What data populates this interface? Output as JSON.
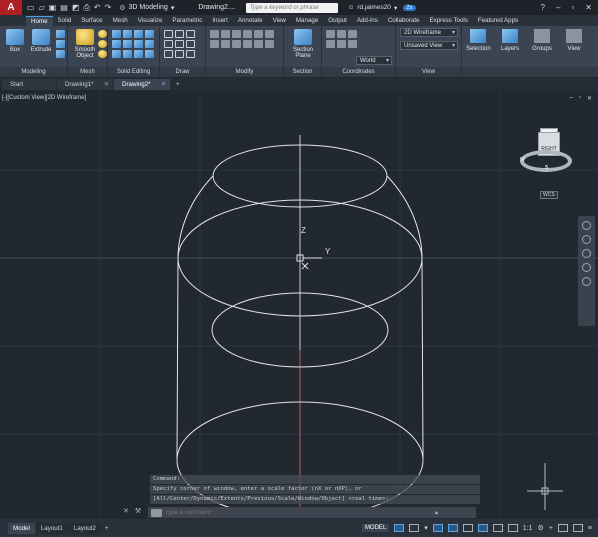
{
  "titlebar": {
    "logo": "A",
    "workspace": "3D Modeling",
    "document_title": "Drawing2....",
    "search_placeholder": "Type a keyword or phrase",
    "username": "rd.jaimes20",
    "cart_badge": "2s"
  },
  "ribbon_tabs": [
    "Home",
    "Solid",
    "Surface",
    "Mesh",
    "Visualize",
    "Parametric",
    "Insert",
    "Annotate",
    "View",
    "Manage",
    "Output",
    "Add-ins",
    "Collaborate",
    "Express Tools",
    "Featured Apps"
  ],
  "ribbon": {
    "box_label": "Box",
    "extrude_label": "Extrude",
    "smooth_object_label": "Smooth Object",
    "section_plane_label": "Section Plane",
    "visual_style": "2D Wireframe",
    "view_state": "Unsaved View",
    "ucs": "World",
    "selection_label": "Selection",
    "layers_label": "Layers",
    "groups_label": "Groups",
    "view_label": "View",
    "panel_labels": {
      "modeling": "Modeling",
      "mesh": "Mesh",
      "solid_editing": "Solid Editing",
      "draw": "Draw",
      "modify": "Modify",
      "section": "Section",
      "coordinates": "Coordinates",
      "view": "View"
    }
  },
  "document_tabs": [
    {
      "label": "Start",
      "active": false
    },
    {
      "label": "Drawing1*",
      "active": false
    },
    {
      "label": "Drawing2*",
      "active": true
    }
  ],
  "viewport": {
    "label": "[-][Custom View][2D Wireframe]",
    "ucs_z": "Z",
    "ucs_y": "Y",
    "viewcube_face": "RIGHT",
    "wcs": "WCS"
  },
  "command": {
    "history": [
      "Command:",
      "Specify corner of window, enter a scale factor (nX or nXP), or",
      "[All/Center/Dynamic/Extents/Previous/Scale/Window/Object] <real time>:"
    ],
    "placeholder": "Type a command"
  },
  "status": {
    "layout_tabs": [
      {
        "label": "Model",
        "active": true
      },
      {
        "label": "Layout1",
        "active": false
      },
      {
        "label": "Layout2",
        "active": false
      }
    ],
    "model_button": "MODEL",
    "scale": "1:1"
  }
}
